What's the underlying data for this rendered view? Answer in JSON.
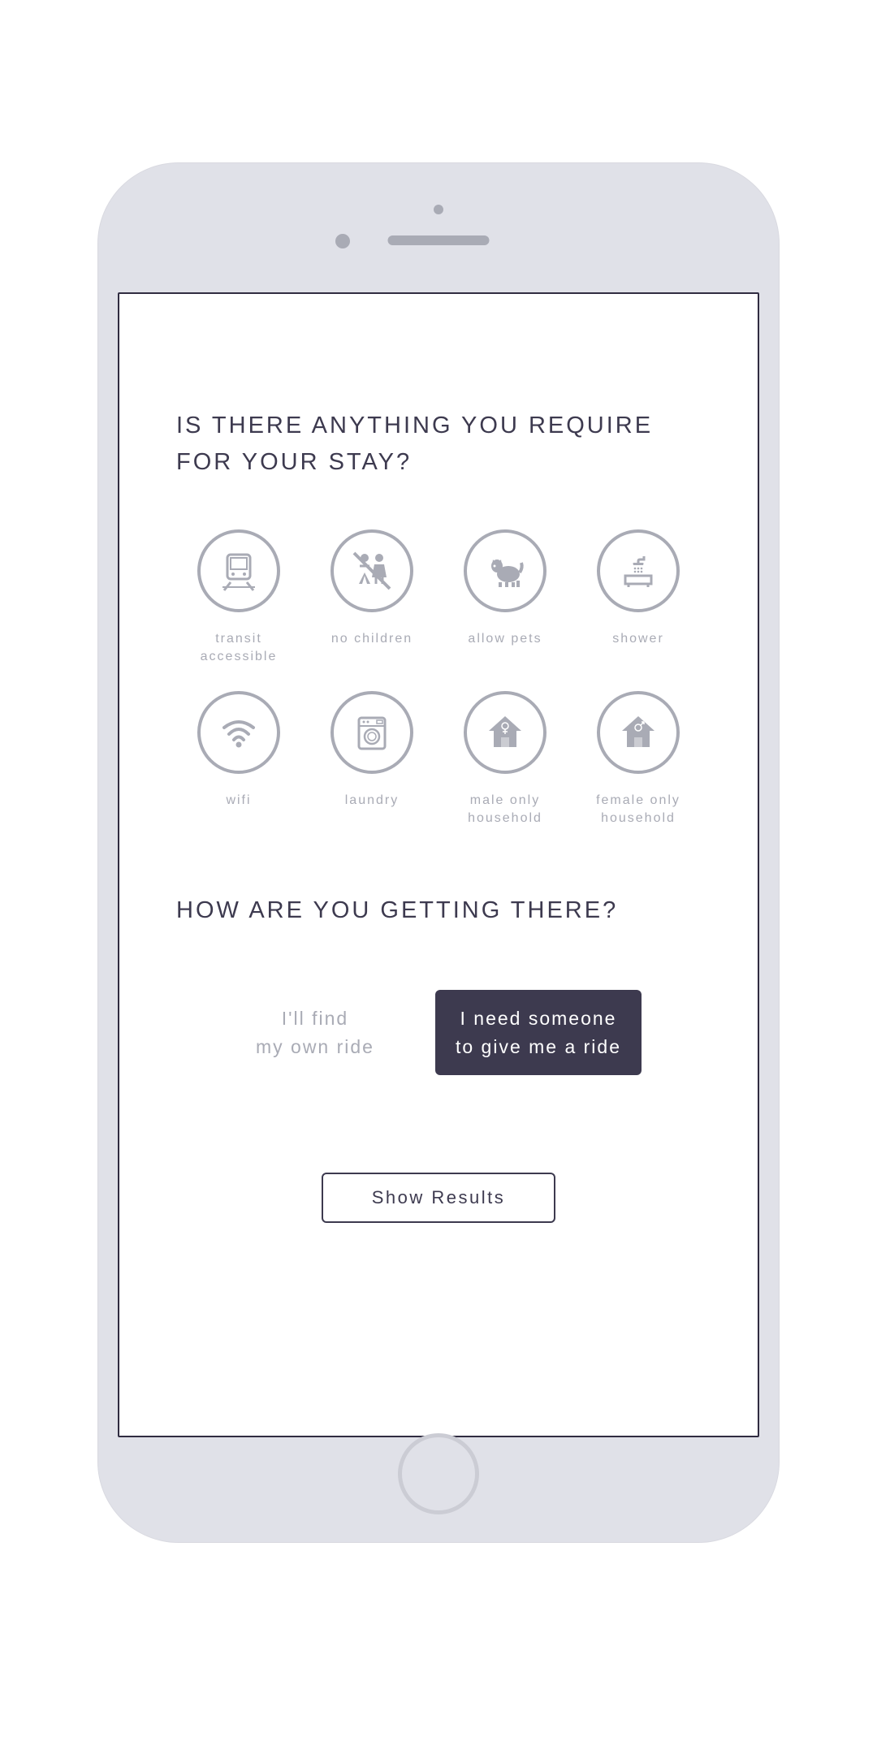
{
  "headings": {
    "requirements": "IS THERE ANYTHING YOU REQUIRE FOR YOUR STAY?",
    "transport": "HOW ARE YOU GETTING THERE?"
  },
  "requirements": [
    {
      "icon": "transit",
      "label": "transit accessible"
    },
    {
      "icon": "no-children",
      "label": "no children"
    },
    {
      "icon": "allow-pets",
      "label": "allow pets"
    },
    {
      "icon": "shower",
      "label": "shower"
    },
    {
      "icon": "wifi",
      "label": "wifi"
    },
    {
      "icon": "laundry",
      "label": "laundry"
    },
    {
      "icon": "male-household",
      "label": "male only household"
    },
    {
      "icon": "female-household",
      "label": "female only household"
    }
  ],
  "ride": {
    "own": "I'll find\nmy own ride",
    "need": "I need someone\nto give me a ride"
  },
  "buttons": {
    "showResults": "Show Results"
  },
  "colors": {
    "iconGrey": "#a9abb5",
    "textDark": "#3d3a4f",
    "activeDark": "#3d3a4f"
  }
}
